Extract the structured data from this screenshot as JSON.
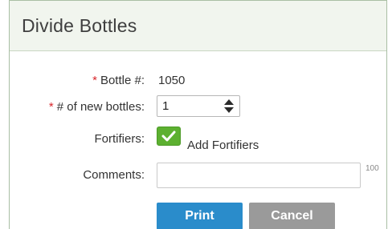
{
  "dialog": {
    "title": "Divide Bottles"
  },
  "form": {
    "bottle_number": {
      "required_mark": "*",
      "label": "Bottle #:",
      "value": "1050"
    },
    "new_bottles": {
      "required_mark": "*",
      "label": "# of new bottles:",
      "value": "1"
    },
    "fortifiers": {
      "label": "Fortifiers:",
      "checkbox_label": "Add Fortifiers",
      "checked": true
    },
    "comments": {
      "label": "Comments:",
      "value": "",
      "max_length": "100"
    }
  },
  "actions": {
    "print_label": "Print",
    "cancel_label": "Cancel"
  },
  "colors": {
    "required": "#d8262c",
    "checkbox": "#5cb030",
    "primary_button": "#2a8ccb",
    "secondary_button": "#9a9a9a",
    "header_bg": "#f1f5ee"
  },
  "icons": {
    "stepper": "up-down-arrows-icon",
    "checkbox": "checkmark-icon"
  }
}
